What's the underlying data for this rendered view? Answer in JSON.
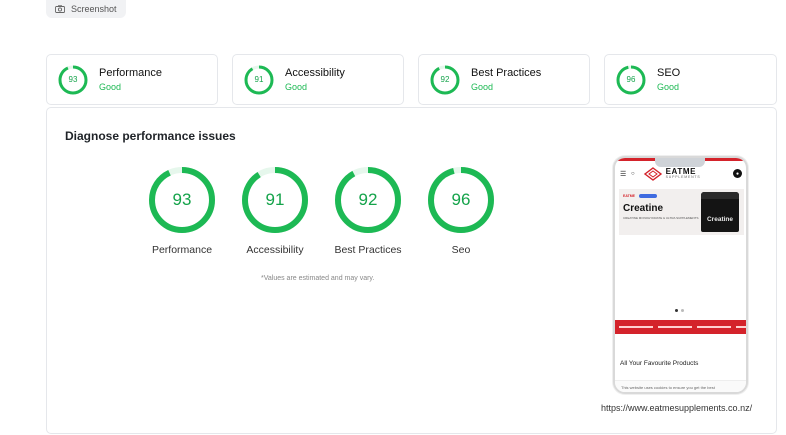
{
  "screenshot_tab": {
    "label": "Screenshot",
    "icon": "camera-icon"
  },
  "accent_color": "#1db954",
  "summary_cards": [
    {
      "score": 93,
      "score_text": "93",
      "title": "Performance",
      "status": "Good"
    },
    {
      "score": 91,
      "score_text": "91",
      "title": "Accessibility",
      "status": "Good"
    },
    {
      "score": 92,
      "score_text": "92",
      "title": "Best Practices",
      "status": "Good"
    },
    {
      "score": 96,
      "score_text": "96",
      "title": "SEO",
      "status": "Good"
    }
  ],
  "diagnose": {
    "title": "Diagnose performance issues",
    "gauges": [
      {
        "score": 93,
        "score_text": "93",
        "label": "Performance"
      },
      {
        "score": 91,
        "score_text": "91",
        "label": "Accessibility"
      },
      {
        "score": 92,
        "score_text": "92",
        "label": "Best Practices"
      },
      {
        "score": 96,
        "score_text": "96",
        "label": "Seo"
      }
    ],
    "note": "*Values are estimated and may vary."
  },
  "preview": {
    "logo_main": "EATME",
    "logo_sub": "SUPPLEMENTS",
    "banner_label": "EATME",
    "banner_heading": "Creatine",
    "banner_sub": "CREATINE MONOHYDRATE & ULTRA SUPPLEMENTS",
    "product_text": "Creatine",
    "section_heading": "All Your Favourite Products",
    "cookie_text": "This website uses cookies to ensure you get the best",
    "url": "https://www.eatmesupplements.co.nz/"
  }
}
